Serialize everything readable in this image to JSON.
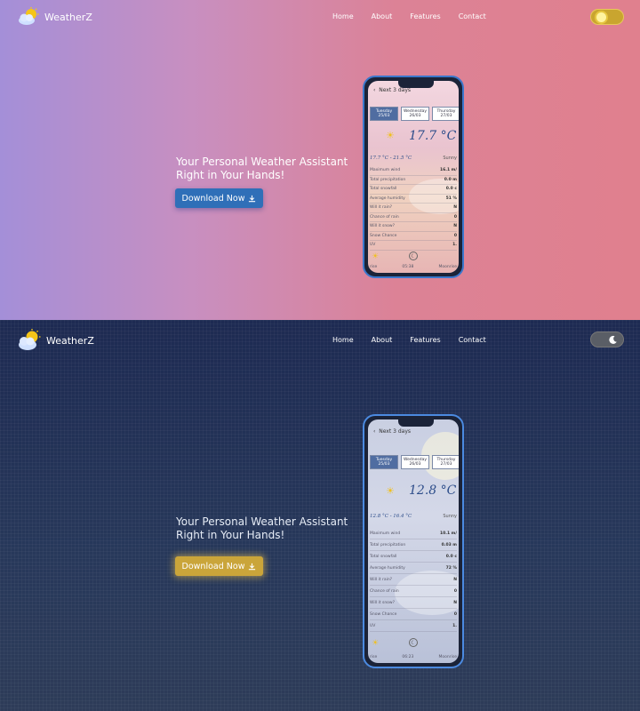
{
  "app": {
    "name": "WeatherZ"
  },
  "nav": [
    "Home",
    "About",
    "Features",
    "Contact"
  ],
  "hero": {
    "title": "Your Personal Weather Assistant Right in Your Hands!",
    "download_label": "Download Now"
  },
  "colors": {
    "light_gradient_start": "#a48fd8",
    "light_gradient_end": "#e0808e",
    "dark_bg": "#263455",
    "light_button": "#2f6fb8",
    "dark_button": "#caa53a"
  },
  "light_phone": {
    "header": "Next 3 days",
    "days": [
      {
        "name": "Tuesday",
        "date": "25/03"
      },
      {
        "name": "Wednesday",
        "date": "26/03"
      },
      {
        "name": "Thursday",
        "date": "27/03"
      }
    ],
    "temperature": "17.7 °C",
    "range": "17.7 °C - 21.5 °C",
    "condition": "Sunny",
    "rows": [
      {
        "label": "Maximum wind",
        "value": "16.1 m/"
      },
      {
        "label": "Total precipitation",
        "value": "0.0 m"
      },
      {
        "label": "Total snowfall",
        "value": "0.0 c"
      },
      {
        "label": "Average humidity",
        "value": "51 %"
      },
      {
        "label": "Will it rain?",
        "value": "N"
      },
      {
        "label": "Chance of rain",
        "value": "0"
      },
      {
        "label": "Will it snow?",
        "value": "N"
      },
      {
        "label": "Snow Chance",
        "value": "0"
      },
      {
        "label": "UV",
        "value": "1."
      }
    ],
    "bottom_left": "rise",
    "bottom_mid": "05:38",
    "bottom_right": "Moonrise"
  },
  "dark_phone": {
    "header": "Next 3 days",
    "days": [
      {
        "name": "Tuesday",
        "date": "25/03"
      },
      {
        "name": "Wednesday",
        "date": "26/03"
      },
      {
        "name": "Thursday",
        "date": "27/03"
      }
    ],
    "temperature": "12.8 °C",
    "range": "12.8 °C - 16.4 °C",
    "condition": "Sunny",
    "rows": [
      {
        "label": "Maximum wind",
        "value": "10.1 m/"
      },
      {
        "label": "Total precipitation",
        "value": "0.03 m"
      },
      {
        "label": "Total snowfall",
        "value": "0.0 c"
      },
      {
        "label": "Average humidity",
        "value": "72 %"
      },
      {
        "label": "Will it rain?",
        "value": "N"
      },
      {
        "label": "Chance of rain",
        "value": "0"
      },
      {
        "label": "Will it snow?",
        "value": "N"
      },
      {
        "label": "Snow Chance",
        "value": "0"
      },
      {
        "label": "UV",
        "value": "1."
      }
    ],
    "bottom_left": "rise",
    "bottom_mid": "06:23",
    "bottom_right": "Moonrise"
  }
}
